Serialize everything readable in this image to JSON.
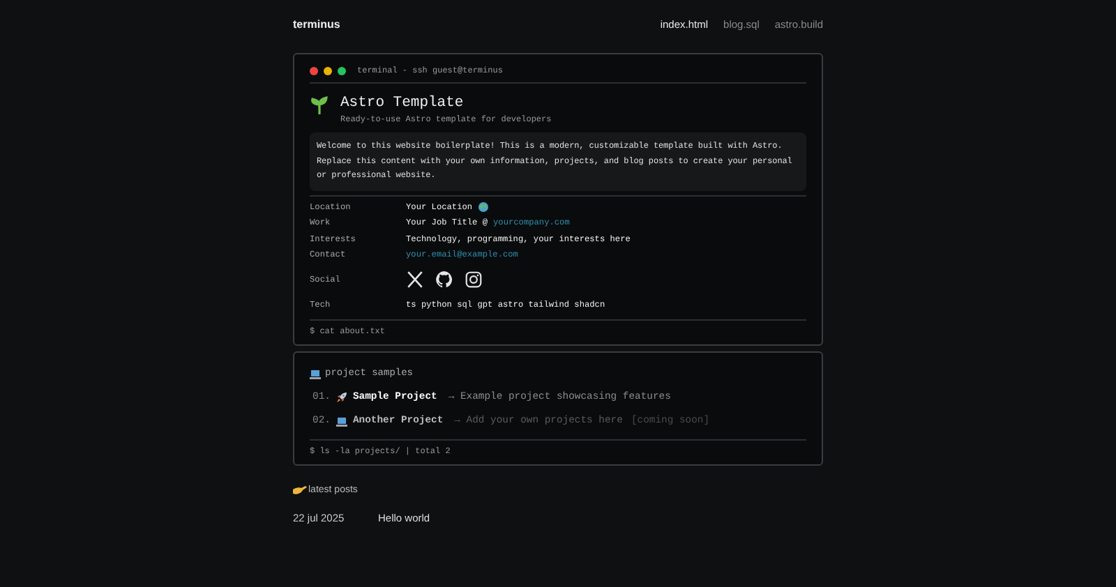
{
  "header": {
    "brand": "terminus",
    "nav": [
      {
        "label": "index.html",
        "selected": true
      },
      {
        "label": "blog.sql",
        "selected": false
      },
      {
        "label": "astro.build",
        "selected": false
      }
    ]
  },
  "terminal": {
    "title": "terminal - ssh guest@terminus",
    "name": "Astro Template",
    "tagline": "Ready-to-use Astro template for developers",
    "intro": "Welcome to this website boilerplate! This is a modern, customizable template built with Astro. Replace this content with your own information, projects, and blog posts to create your personal or professional website.",
    "rows": [
      {
        "label": "Location",
        "kind": "location",
        "value": "Your Location"
      },
      {
        "label": "Work",
        "kind": "text",
        "value": "Your Job Title @",
        "link": "yourcompany.com"
      },
      {
        "label": "Interests",
        "kind": "text",
        "value": "Technology, programming, your interests here"
      },
      {
        "label": "Contact",
        "kind": "text",
        "link": "your.email@example.com"
      },
      {
        "label": "Social",
        "kind": "social"
      },
      {
        "label": "Tech",
        "kind": "text",
        "value": "ts python sql gpt astro tailwind shadcn"
      }
    ],
    "prompt": "$ cat about.txt"
  },
  "projects": {
    "heading": "project samples",
    "items": [
      {
        "number": "01.",
        "kind": "rocket",
        "title": "Sample Project",
        "description": "→ Example project showcasing features",
        "upcoming": false
      },
      {
        "number": "02.",
        "kind": "laptop",
        "title": "Another Project",
        "description": "→ Add your own projects here",
        "note": "[coming soon]",
        "upcoming": true
      }
    ],
    "prompt": "$ ls -la projects/ | total 2"
  },
  "posts": {
    "heading": "latest posts",
    "items": [
      {
        "date": "22 jul 2025",
        "title": "Hello world"
      }
    ]
  }
}
